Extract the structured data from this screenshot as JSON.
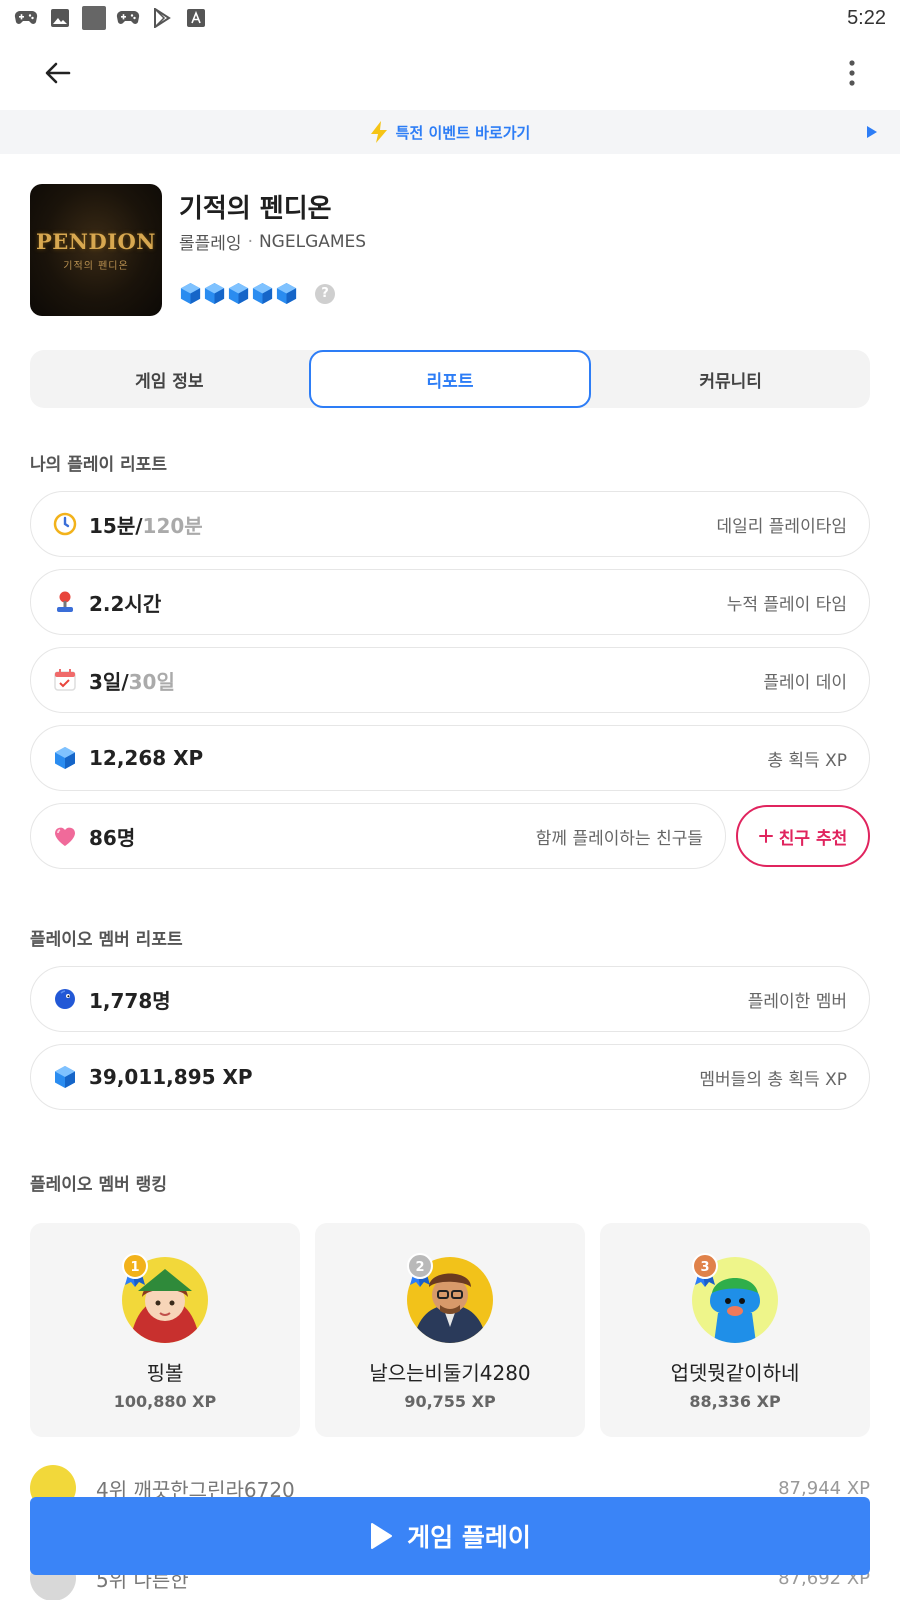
{
  "status_bar": {
    "time": "5:22"
  },
  "promo": {
    "text": "특전 이벤트 바로가기"
  },
  "game": {
    "logo_text": "PENDION",
    "logo_sub": "기적의 펜디온",
    "title": "기적의 펜디온",
    "genre": "롤플레잉",
    "separator": "·",
    "developer": "NGELGAMES",
    "rating_help": "?"
  },
  "tabs": [
    {
      "label": "게임 정보"
    },
    {
      "label": "리포트"
    },
    {
      "label": "커뮤니티"
    }
  ],
  "my_report": {
    "title": "나의 플레이 리포트",
    "daily": {
      "value": "15분",
      "slash": "/",
      "max": "120분",
      "label": "데일리 플레이타임"
    },
    "total_time": {
      "value": "2.2시간",
      "label": "누적 플레이 타임"
    },
    "days": {
      "value": "3일",
      "slash": "/",
      "max": "30일",
      "label": "플레이 데이"
    },
    "xp": {
      "value": "12,268 XP",
      "label": "총 획득 XP"
    },
    "friends": {
      "value": "86명",
      "label": "함께 플레이하는 친구들",
      "button": "친구 추천"
    }
  },
  "member_report": {
    "title": "플레이오 멤버 리포트",
    "members": {
      "value": "1,778명",
      "label": "플레이한 멤버"
    },
    "xp": {
      "value": "39,011,895 XP",
      "label": "멤버들의 총 획득 XP"
    }
  },
  "ranking": {
    "title": "플레이오 멤버 랭킹",
    "top": [
      {
        "rank": "1",
        "name": "핑볼",
        "xp": "100,880 XP"
      },
      {
        "rank": "2",
        "name": "날으는비둘기4280",
        "xp": "90,755 XP"
      },
      {
        "rank": "3",
        "name": "업뎃뭣같이하네",
        "xp": "88,336 XP"
      }
    ],
    "list": [
      {
        "text": "4위 깨끗한그린라6720",
        "xp": "87,944 XP"
      },
      {
        "text": "5위 나른한",
        "xp": "87,692 XP"
      }
    ]
  },
  "play_button": {
    "label": "게임 플레이"
  },
  "colors": {
    "accent": "#2d7df6",
    "pink": "#e0245e",
    "play": "#3a84f7"
  }
}
